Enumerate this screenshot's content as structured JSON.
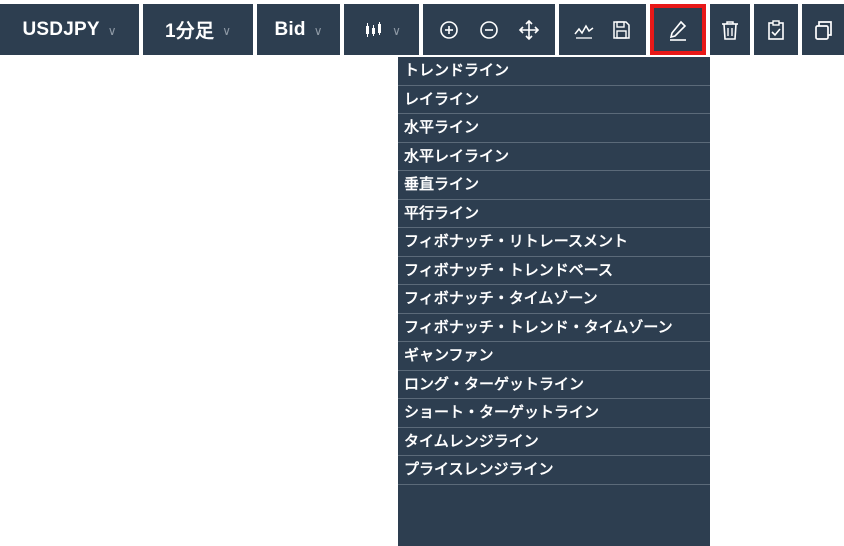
{
  "toolbar": {
    "symbol": {
      "label": "USDJPY",
      "chevron": "chevron-down-icon"
    },
    "timeframe": {
      "label": "1分足",
      "chevron": "chevron-down-icon"
    },
    "price_type": {
      "label": "Bid",
      "chevron": "chevron-down-icon"
    },
    "chart_type": {
      "icon": "candlestick-chart-icon",
      "chevron": "chevron-down-icon"
    },
    "tools": [
      "zoom-in-icon",
      "zoom-out-icon",
      "move-icon",
      "indicator-icon",
      "save-icon",
      "pencil-icon",
      "trash-icon",
      "clipboard-check-icon",
      "copy-icon"
    ],
    "active_tool": "pencil-icon",
    "highlight_color": "#e81818"
  },
  "drawing_menu": {
    "items": [
      "トレンドライン",
      "レイライン",
      "水平ライン",
      "水平レイライン",
      "垂直ライン",
      "平行ライン",
      "フィボナッチ・リトレースメント",
      "フィボナッチ・トレンドベース",
      "フィボナッチ・タイムゾーン",
      "フィボナッチ・トレンド・タイムゾーン",
      "ギャンファン",
      "ロング・ターゲットライン",
      "ショート・ターゲットライン",
      "タイムレンジライン",
      "プライスレンジライン"
    ]
  },
  "colors": {
    "toolbar_bg": "#2d3e50",
    "menu_bg": "#2d3e50",
    "separator": "#5b6a79",
    "text": "#ffffff"
  }
}
